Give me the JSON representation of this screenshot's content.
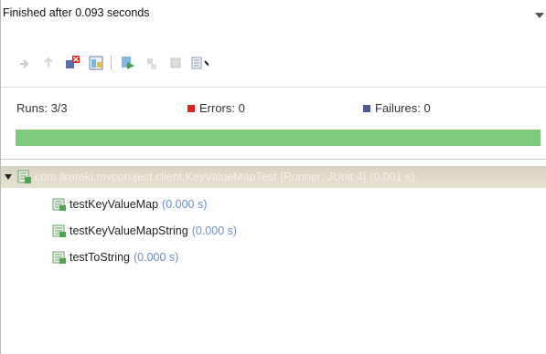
{
  "status": {
    "text": "Finished after 0.093 seconds"
  },
  "counters": {
    "runs": "Runs:  3/3",
    "errors": "Errors:  0",
    "failures": "Failures:  0"
  },
  "progress": {
    "fraction": 1.0,
    "color": "#7ec97b"
  },
  "toolbar": {
    "icons": [
      "next-failure-icon",
      "previous-failure-icon",
      "show-failures-only-icon",
      "scroll-lock-icon",
      "rerun-icon",
      "rerun-failed-first-icon",
      "stop-icon",
      "history-icon"
    ]
  },
  "suite": {
    "name": "com.fkereki.mvpproject.client.KeyValueMapTest",
    "runner": "[Runner: JUnit 4]",
    "time": "(0.001 s)"
  },
  "tests": [
    {
      "name": "testKeyValueMap",
      "time": "(0.000 s)"
    },
    {
      "name": "testKeyValueMapString",
      "time": "(0.000 s)"
    },
    {
      "name": "testToString",
      "time": "(0.000 s)"
    }
  ],
  "colors": {
    "error": "#d9261c",
    "failure": "#4b5a8a",
    "time": "#6a8fc0",
    "suite_bg": "#d8d2c2"
  }
}
